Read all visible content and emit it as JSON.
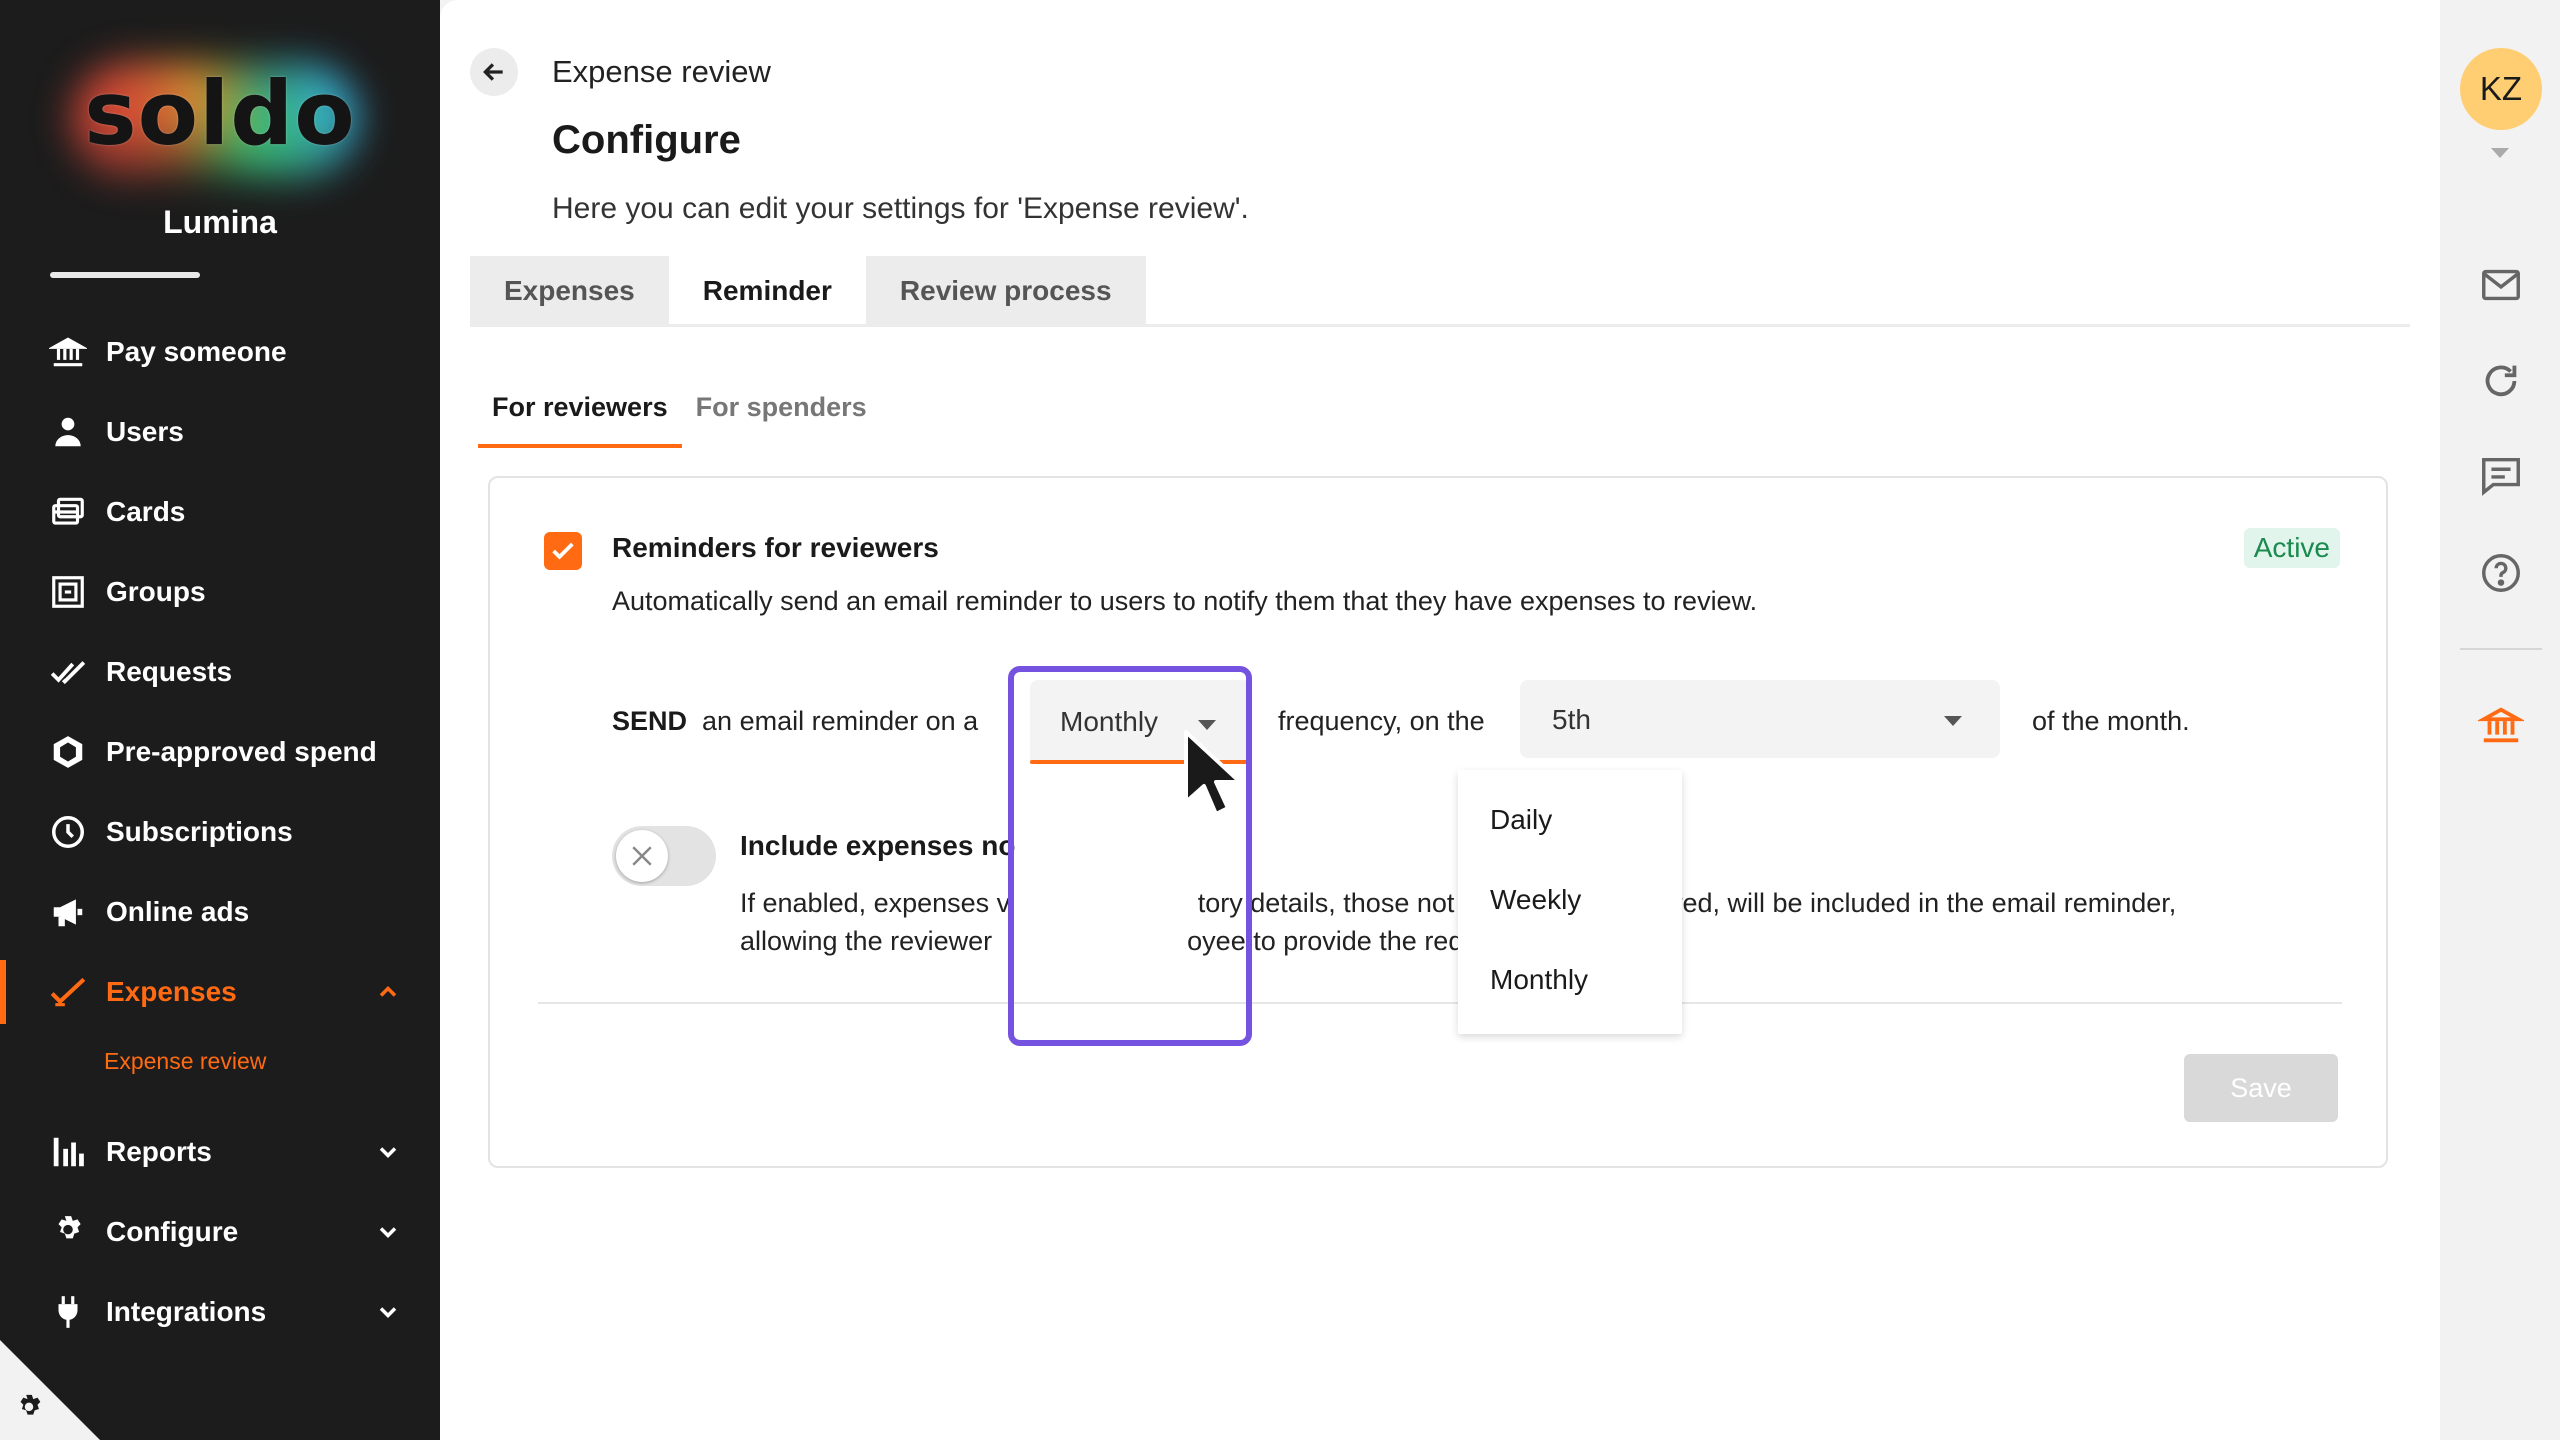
{
  "brand": {
    "logo": "soldo",
    "org": "Lumina",
    "accent": "#ff6a13"
  },
  "sidebar": {
    "items": [
      {
        "label": "Pay someone",
        "icon": "bank-transfer-icon"
      },
      {
        "label": "Users",
        "icon": "user-icon"
      },
      {
        "label": "Cards",
        "icon": "cards-icon"
      },
      {
        "label": "Groups",
        "icon": "groups-icon"
      },
      {
        "label": "Requests",
        "icon": "double-check-icon"
      },
      {
        "label": "Pre-approved spend",
        "icon": "hexagon-icon"
      },
      {
        "label": "Subscriptions",
        "icon": "clock-icon"
      },
      {
        "label": "Online ads",
        "icon": "megaphone-icon"
      },
      {
        "label": "Expenses",
        "icon": "checkmark-icon"
      },
      {
        "label": "Reports",
        "icon": "bar-chart-icon"
      },
      {
        "label": "Configure",
        "icon": "gear-icon"
      },
      {
        "label": "Integrations",
        "icon": "plug-icon"
      }
    ],
    "sub_item": "Expense review"
  },
  "header": {
    "breadcrumb": "Expense review",
    "title": "Configure",
    "description": "Here you can edit your settings for 'Expense review'."
  },
  "tabs": [
    {
      "label": "Expenses"
    },
    {
      "label": "Reminder"
    },
    {
      "label": "Review process"
    }
  ],
  "subtabs": [
    {
      "label": "For reviewers"
    },
    {
      "label": "For spenders"
    }
  ],
  "card": {
    "title": "Reminders for reviewers",
    "status": "Active",
    "description": "Automatically send an email reminder to users to notify them that they have expenses to review.",
    "send_bold": "SEND",
    "send_text": "an email reminder on a",
    "frequency_value": "Monthly",
    "frequency_label": "frequency, on the",
    "day_value": "5th",
    "month_label": "of the month.",
    "include_title": "Include expenses no",
    "include_desc_line1": "If enabled, expenses v                         tory details, those not ready to be reviewed, will be included in the email reminder,",
    "include_desc_line2": "allowing the reviewer                          oyee to provide the required information.",
    "save_label": "Save"
  },
  "dropdown": {
    "options": [
      "Daily",
      "Weekly",
      "Monthly"
    ]
  },
  "rail": {
    "avatar": "KZ"
  }
}
